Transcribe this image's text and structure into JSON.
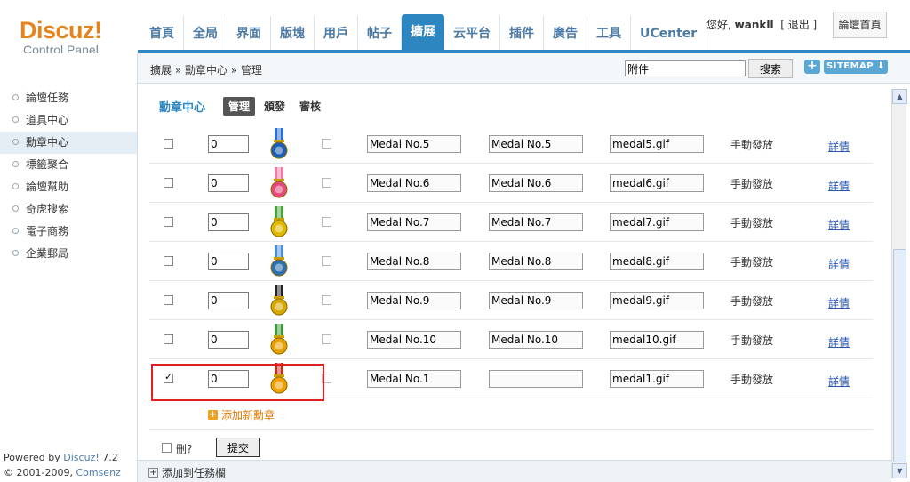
{
  "header": {
    "logo_main": "Discuz!",
    "logo_sub": "Control Panel",
    "nav": [
      "首頁",
      "全局",
      "界面",
      "版塊",
      "用戶",
      "帖子",
      "擴展",
      "云平台",
      "插件",
      "廣告",
      "工具",
      "UCenter"
    ],
    "active_nav": "擴展",
    "greeting": "您好,",
    "username": "wankll",
    "logout": "[ 退出 ]",
    "forum_home": "論壇首頁"
  },
  "breadcrumb": "擴展 » 勳章中心 » 管理",
  "search": {
    "value": "附件",
    "button": "搜索"
  },
  "toolbar": {
    "plus": "+",
    "sitemap": "SITEMAP ⬇"
  },
  "sidebar": {
    "items": [
      "論壇任務",
      "道具中心",
      "勳章中心",
      "標籤聚合",
      "論壇幫助",
      "奇虎搜索",
      "電子商務",
      "企業郵局"
    ],
    "active": "勳章中心"
  },
  "footer": {
    "powered_prefix": "Powered by ",
    "powered_link": "Discuz!",
    "version": " 7.2",
    "copyright_prefix": "© 2001-2009, ",
    "copyright_link": "Comsenz Inc."
  },
  "section": {
    "title": "勳章中心",
    "tabs": [
      "管理",
      "頒發",
      "審核"
    ],
    "active_tab": "管理"
  },
  "medals": [
    {
      "checked": false,
      "order": "0",
      "name": "Medal No.5",
      "desc": "Medal No.5",
      "image": "medal5.gif",
      "award": "手動發放",
      "detail": "詳情",
      "color": "#1e5fb3",
      "ribbon": "#2a6fd0"
    },
    {
      "checked": false,
      "order": "0",
      "name": "Medal No.6",
      "desc": "Medal No.6",
      "image": "medal6.gif",
      "award": "手動發放",
      "detail": "詳情",
      "color": "#e24a7a",
      "ribbon": "#f07aa0"
    },
    {
      "checked": false,
      "order": "0",
      "name": "Medal No.7",
      "desc": "Medal No.7",
      "image": "medal7.gif",
      "award": "手動發放",
      "detail": "詳情",
      "color": "#e0b800",
      "ribbon": "#48a23a"
    },
    {
      "checked": false,
      "order": "0",
      "name": "Medal No.8",
      "desc": "Medal No.8",
      "image": "medal8.gif",
      "award": "手動發放",
      "detail": "詳情",
      "color": "#2e6fb0",
      "ribbon": "#4a90d8"
    },
    {
      "checked": false,
      "order": "0",
      "name": "Medal No.9",
      "desc": "Medal No.9",
      "image": "medal9.gif",
      "award": "手動發放",
      "detail": "詳情",
      "color": "#d8a800",
      "ribbon": "#222222"
    },
    {
      "checked": false,
      "order": "0",
      "name": "Medal No.10",
      "desc": "Medal No.10",
      "image": "medal10.gif",
      "award": "手動發放",
      "detail": "詳情",
      "color": "#e8a000",
      "ribbon": "#3a9a3a"
    },
    {
      "checked": true,
      "order": "0",
      "name": "Medal No.1",
      "desc": "",
      "image": "medal1.gif",
      "award": "手動發放",
      "detail": "詳情",
      "color": "#f0a000",
      "ribbon": "#c03020"
    }
  ],
  "add_medal": "添加新勳章",
  "delete_label": "刪?",
  "submit": "提交",
  "add_task": "添加到任務欄"
}
